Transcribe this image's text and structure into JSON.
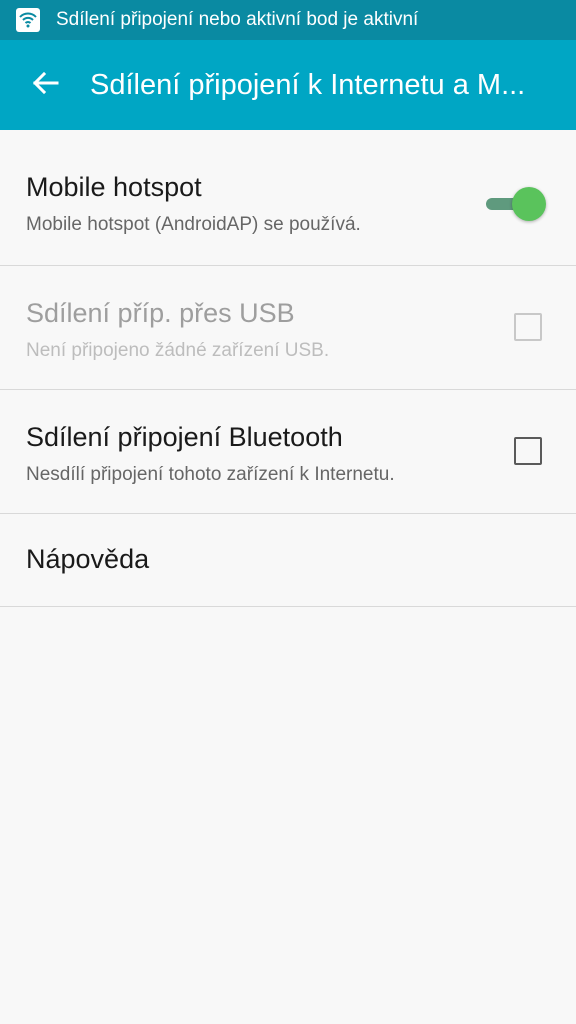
{
  "status_bar": {
    "icon": "wifi-hotspot-icon",
    "text": "Sdílení připojení nebo aktivní bod je aktivní"
  },
  "app_bar": {
    "back_icon": "arrow-back-icon",
    "title": "Sdílení připojení k Internetu a M..."
  },
  "settings": {
    "mobile_hotspot": {
      "title": "Mobile hotspot",
      "subtitle": "Mobile hotspot (AndroidAP) se používá.",
      "enabled": true
    },
    "usb_tethering": {
      "title": "Sdílení příp. přes USB",
      "subtitle": "Není připojeno žádné zařízení USB.",
      "checked": false,
      "disabled": true
    },
    "bluetooth_tethering": {
      "title": "Sdílení připojení Bluetooth",
      "subtitle": "Nesdílí připojení tohoto zařízení k Internetu.",
      "checked": false
    },
    "help": {
      "title": "Nápověda"
    }
  },
  "colors": {
    "status_bar": "#0a8aa2",
    "app_bar": "#00a6c4",
    "toggle_on": "#5ac35c",
    "background": "#f8f8f8"
  }
}
